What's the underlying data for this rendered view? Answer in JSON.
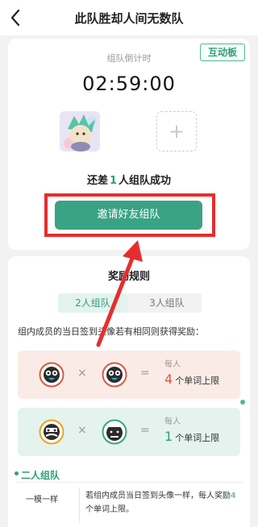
{
  "header": {
    "title": "此队胜却人间无数队"
  },
  "badge": "互动板",
  "timer": {
    "label": "组队倒计时",
    "value": "02:59:00"
  },
  "status": {
    "prefix": "还差",
    "count": "1",
    "suffix": "人组队成功"
  },
  "invite_button": "邀请好友组队",
  "rules": {
    "title": "奖励规则",
    "tabs": [
      "2人组队",
      "3人组队"
    ],
    "desc": "组内成员的当日签到头像若有相同则获得奖励：",
    "box1": {
      "op1": "×",
      "op2": "=",
      "per": "每人",
      "count": "4",
      "text": "个单词上限"
    },
    "box2": {
      "op1": "×",
      "op2": "=",
      "per": "每人",
      "count": "1",
      "text": "个单词上限"
    },
    "section_title": "二人组队",
    "row": {
      "key": "一模一样",
      "value_pre": "若组内成员当日签到头像一样，每人奖励",
      "value_num": "4",
      "value_post": "个单词上限。"
    }
  },
  "colors": {
    "accent": "#3aa383",
    "highlight": "#e62d2d",
    "warm_box": "#fbebe7",
    "green_box": "#e4f3ee"
  },
  "icons": {
    "back": "chevron-left-icon",
    "add": "plus-icon"
  }
}
